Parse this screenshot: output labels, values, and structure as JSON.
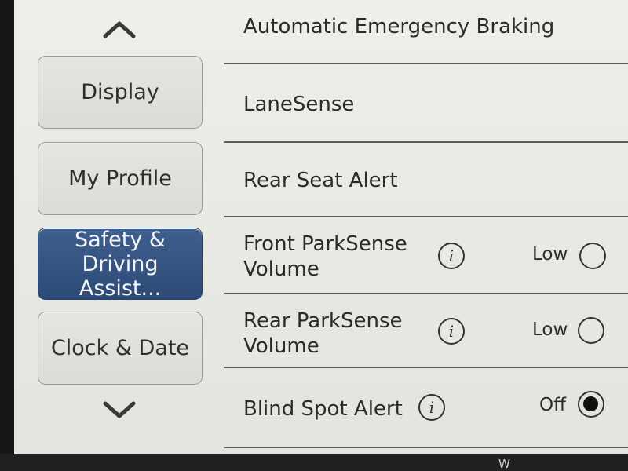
{
  "sidebar": {
    "scroll_up_icon": "chevron-up-icon",
    "scroll_down_icon": "chevron-down-icon",
    "items": [
      {
        "label": "Display",
        "active": false
      },
      {
        "label": "My Profile",
        "active": false
      },
      {
        "label": "Safety &\nDriving Assist...",
        "active": true
      },
      {
        "label": "Clock & Date",
        "active": false
      }
    ]
  },
  "settings": {
    "rows": [
      {
        "label": "Automatic Emergency Braking"
      },
      {
        "label": "LaneSense"
      },
      {
        "label": "Rear Seat Alert"
      },
      {
        "label": "Front ParkSense\nVolume",
        "info_icon": "i",
        "value": "Low",
        "selected": false
      },
      {
        "label": "Rear ParkSense\nVolume",
        "info_icon": "i",
        "value": "Low",
        "selected": false
      },
      {
        "label": "Blind Spot Alert",
        "info_icon": "i",
        "value": "Off",
        "selected": true
      }
    ]
  },
  "bottom_bar": {
    "glyph": "W"
  },
  "colors": {
    "active_button": "#34527f",
    "screen_bg": "#ebebe6",
    "bezel": "#1e1e1f"
  }
}
